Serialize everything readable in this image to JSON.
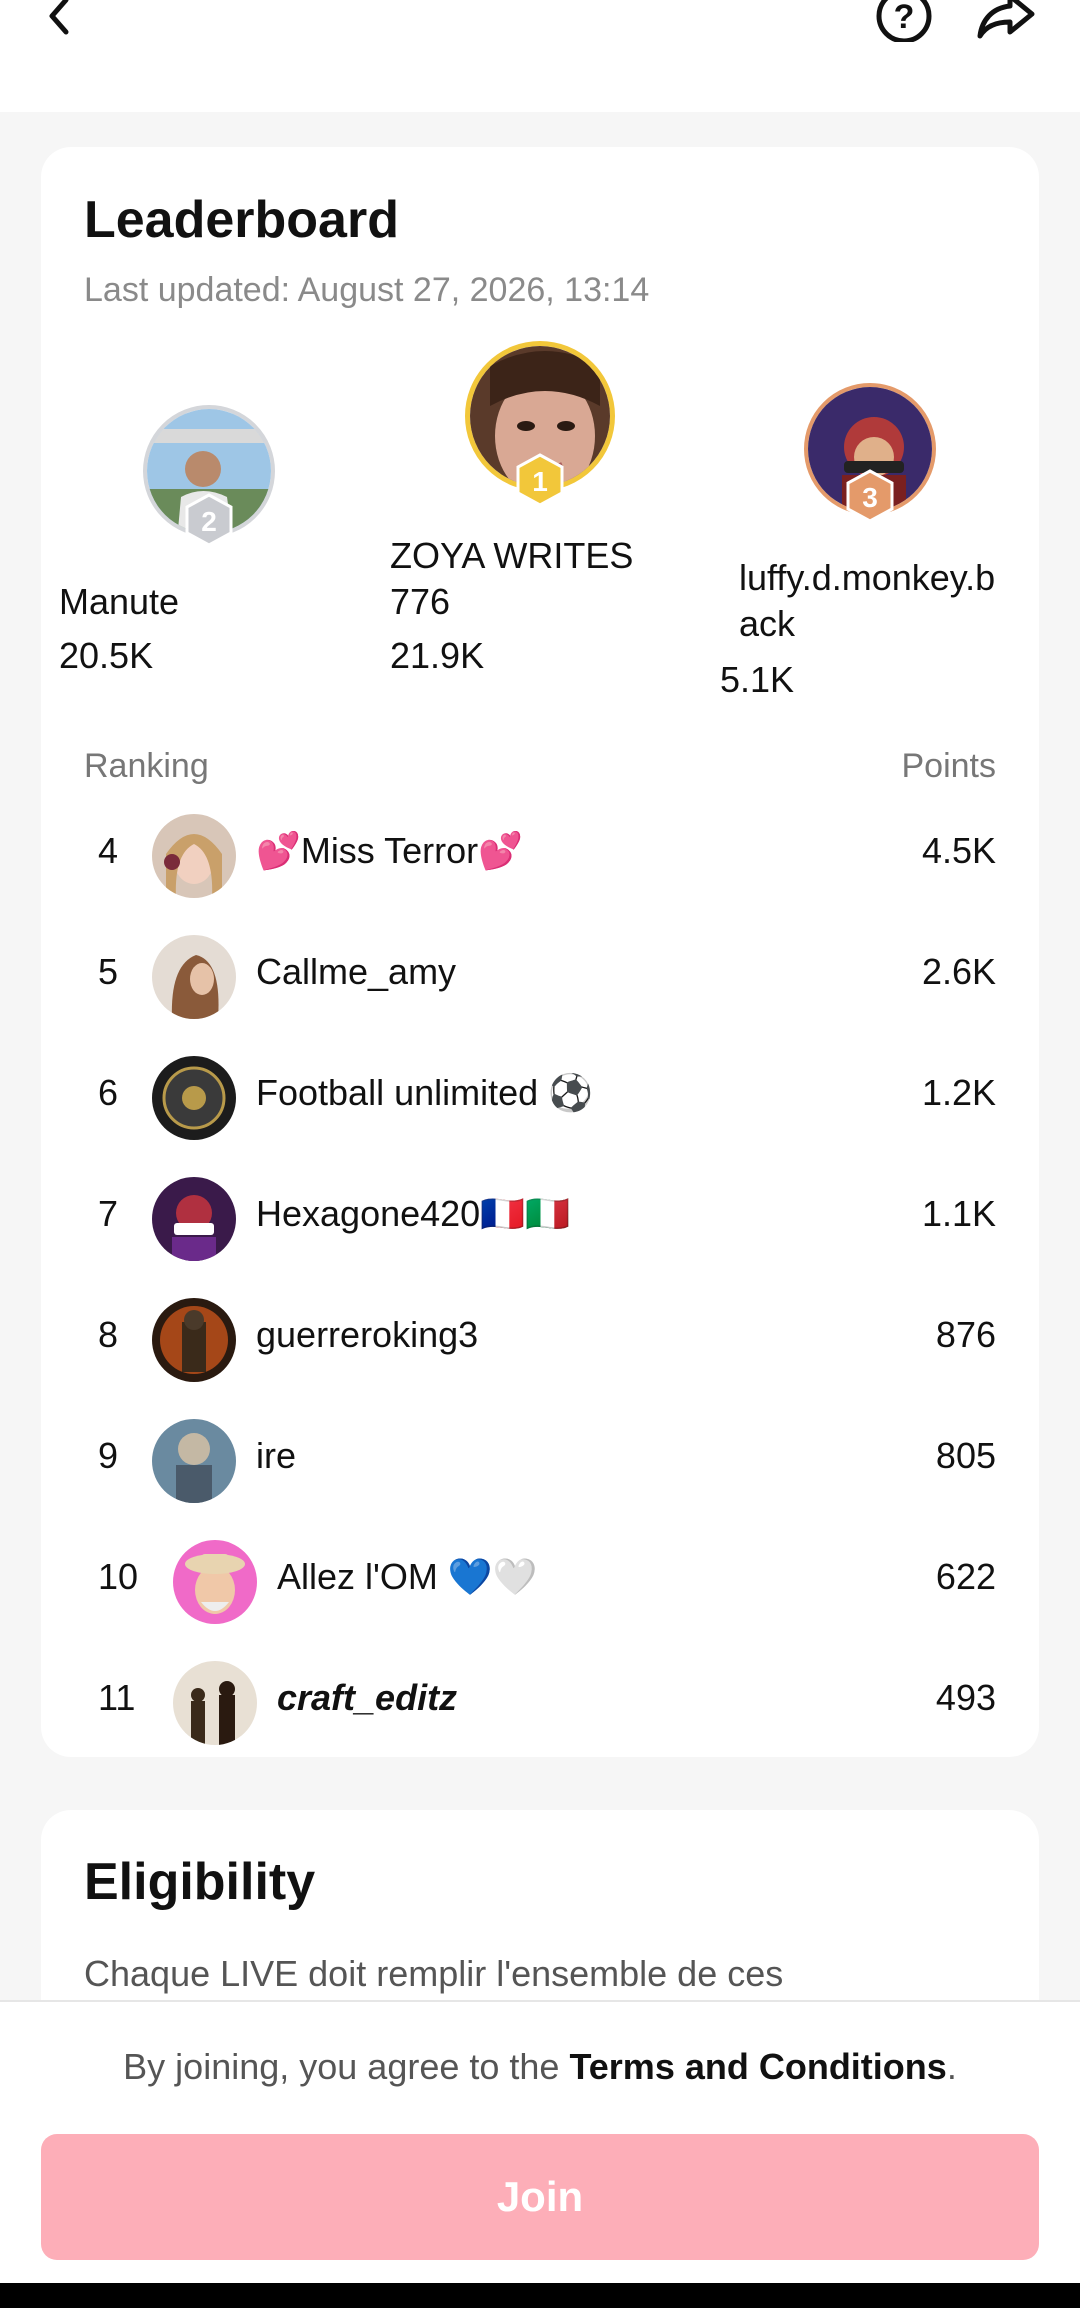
{
  "leaderboard": {
    "title": "Leaderboard",
    "last_updated": "Last updated: August 27, 2026, 13:14",
    "podium": [
      {
        "rank": "2",
        "name": "Manute",
        "points": "20.5K"
      },
      {
        "rank": "1",
        "name": "ZOYA WRITES 776",
        "points": "21.9K"
      },
      {
        "rank": "3",
        "name": "luffy.d.monkey.back",
        "points": "5.1K"
      }
    ],
    "columns": {
      "ranking": "Ranking",
      "points": "Points"
    },
    "rows": [
      {
        "rank": "4",
        "name": "💕Miss Terror💕",
        "points": "4.5K"
      },
      {
        "rank": "5",
        "name": "Callme_amy",
        "points": "2.6K"
      },
      {
        "rank": "6",
        "name": "Football unlimited ⚽",
        "points": "1.2K"
      },
      {
        "rank": "7",
        "name": "Hexagone420🇫🇷🇮🇹",
        "points": "1.1K"
      },
      {
        "rank": "8",
        "name": "guerreroking3",
        "points": "876"
      },
      {
        "rank": "9",
        "name": "ire",
        "points": "805"
      },
      {
        "rank": "10",
        "name": "Allez l'OM 💙🤍",
        "points": "622"
      },
      {
        "rank": "11",
        "name": "craft_editz",
        "points": "493"
      }
    ]
  },
  "eligibility": {
    "title": "Eligibility",
    "text": "Chaque LIVE doit remplir l'ensemble de ces"
  },
  "footer": {
    "terms_prefix": "By joining, you agree to the ",
    "terms_link": "Terms and Conditions",
    "terms_suffix": ".",
    "join_label": "Join"
  },
  "colors": {
    "accent_join": "#fdaeb8",
    "gold": "#f2c73a",
    "silver": "#c9cbd0",
    "bronze": "#e49a6a"
  }
}
